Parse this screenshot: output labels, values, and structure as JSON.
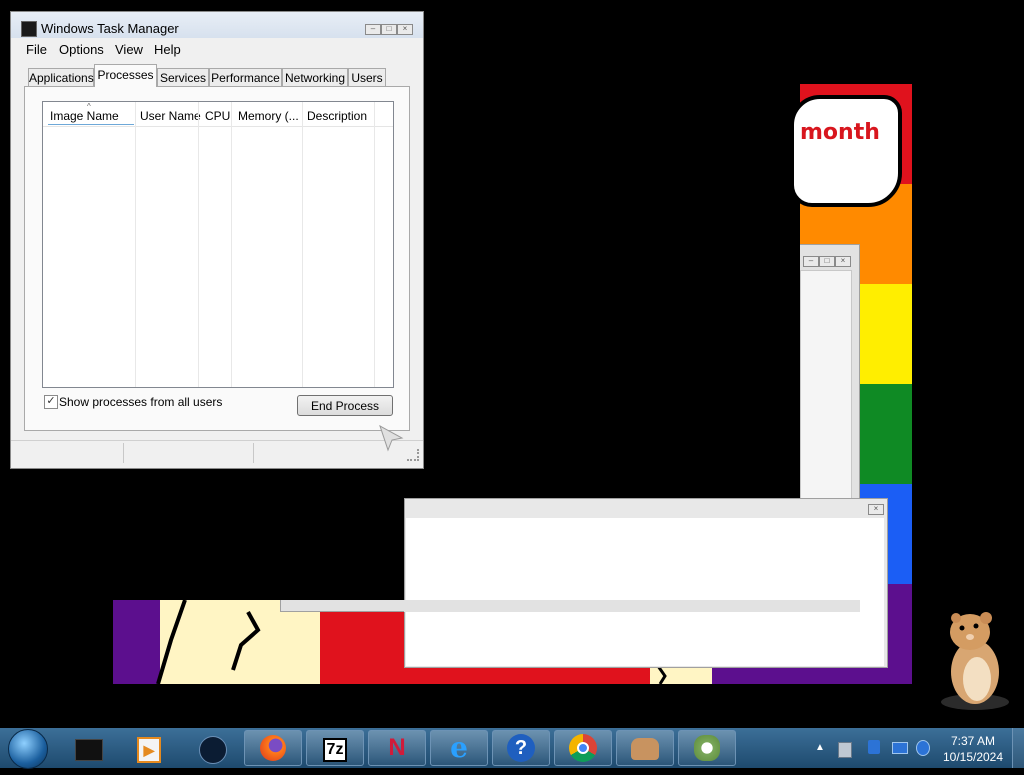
{
  "window": {
    "title": "Windows Task Manager",
    "menu": [
      "File",
      "Options",
      "View",
      "Help"
    ],
    "tabs": [
      "Applications",
      "Processes",
      "Services",
      "Performance",
      "Networking",
      "Users"
    ],
    "active_tab": "Processes",
    "columns": [
      "Image Name",
      "User Name",
      "CPU",
      "Memory (...",
      "Description"
    ],
    "sorted_column": "Image Name",
    "show_all_users": {
      "label": "Show processes from all users",
      "checked": true
    },
    "end_process_label": "End Process"
  },
  "background": {
    "banner_text": "month",
    "colors": {
      "red": "#e0121d",
      "orange": "#ff8a00",
      "yellow": "#ffee00",
      "green": "#0f8a24",
      "blue": "#1b5ef5",
      "purple": "#5c0f8e"
    }
  },
  "taskbar": {
    "start": "start-orb-icon",
    "items": [
      {
        "name": "black-app-icon"
      },
      {
        "name": "media-player-icon"
      },
      {
        "name": "globe-app-icon"
      },
      {
        "name": "firefox-icon"
      },
      {
        "name": "7zip-icon",
        "label": "7z"
      },
      {
        "name": "n-app-icon",
        "label": "N"
      },
      {
        "name": "internet-explorer-icon",
        "label": "e"
      },
      {
        "name": "help-icon",
        "label": "?"
      },
      {
        "name": "chrome-icon"
      },
      {
        "name": "mascot-app-icon"
      },
      {
        "name": "flower-app-icon"
      }
    ],
    "time": "7:37 AM",
    "date": "10/15/2024"
  }
}
